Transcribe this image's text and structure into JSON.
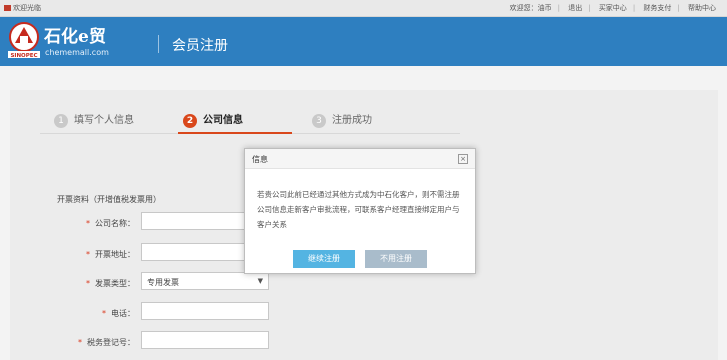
{
  "topbar": {
    "welcome": "欢迎光临",
    "links": [
      "欢迎您：油币",
      "退出",
      "买家中心",
      "财务支付",
      "帮助中心"
    ]
  },
  "header": {
    "logo_text": "石化e贸",
    "logo_sub": "chememall.com",
    "logo_mark": "SINOPEC",
    "title": "会员注册"
  },
  "steps": [
    {
      "num": "1",
      "label": "填写个人信息",
      "state": "done"
    },
    {
      "num": "2",
      "label": "公司信息",
      "state": "active"
    },
    {
      "num": "3",
      "label": "注册成功",
      "state": "pending"
    }
  ],
  "form": {
    "section_title": "开票资料（开增值税发票用）",
    "fields": [
      {
        "label": "公司名称：",
        "value": ""
      },
      {
        "label": "开票地址：",
        "value": ""
      },
      {
        "label": "发票类型：",
        "value": "专用发票"
      },
      {
        "label": "电话：",
        "value": ""
      },
      {
        "label": "税务登记号：",
        "value": ""
      }
    ]
  },
  "modal": {
    "title": "信息",
    "close_glyph": "×",
    "message": "若贵公司此前已经通过其他方式成为中石化客户，则不需注册公司信息走新客户审批流程，可联系客户经理直接绑定用户与客户关系",
    "continue_label": "继续注册",
    "cancel_label": "不用注册"
  },
  "colors": {
    "header_blue": "#2e7fc0",
    "accent_orange": "#d9471b",
    "continue_button": "#54b4e2",
    "cancel_button": "#a9bccb"
  }
}
